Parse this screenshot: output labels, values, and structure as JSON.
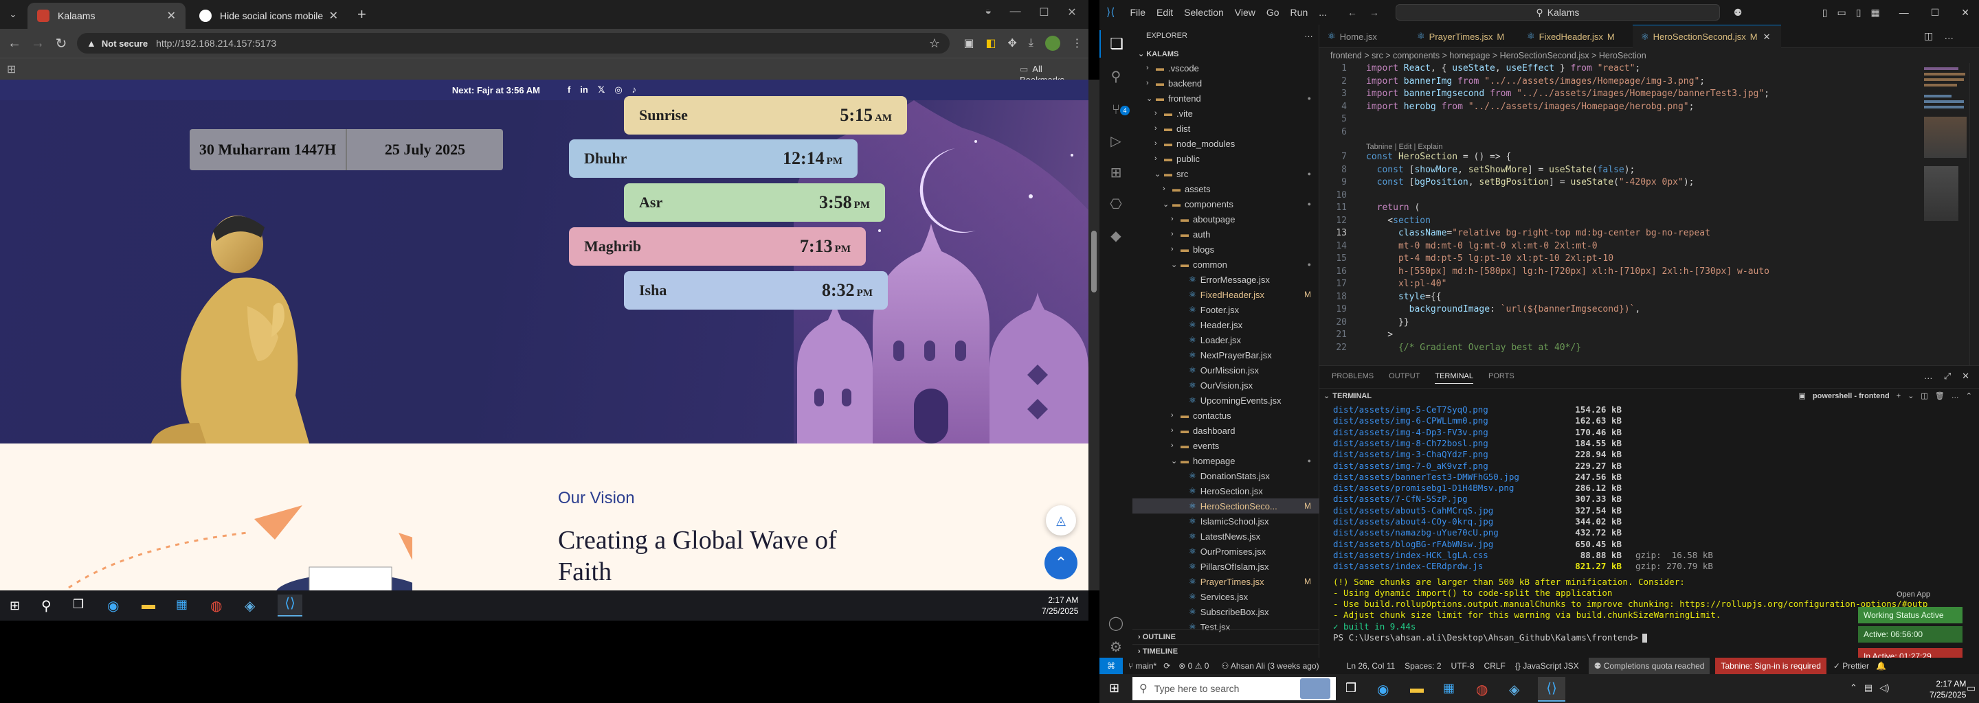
{
  "chrome": {
    "tabs": [
      {
        "label": "Kalaams",
        "active": true
      },
      {
        "label": "Hide social icons mobile",
        "active": false
      }
    ],
    "new_tab": "+",
    "security": "Not secure",
    "url": "http://192.168.214.157:5173",
    "all_bookmarks": "All Bookmarks"
  },
  "site": {
    "topbar": {
      "text": "Next: Fajr at 3:56 AM"
    },
    "dates": {
      "hijri": "30 Muharram 1447H",
      "gregorian": "25 July 2025"
    },
    "prayers": [
      {
        "name": "Sunrise",
        "time": "5:15",
        "ampm": "AM",
        "color": "#e9d7a6"
      },
      {
        "name": "Dhuhr",
        "time": "12:14",
        "ampm": "PM",
        "color": "#a9c7e2"
      },
      {
        "name": "Asr",
        "time": "3:58",
        "ampm": "PM",
        "color": "#b9dcb2"
      },
      {
        "name": "Maghrib",
        "time": "7:13",
        "ampm": "PM",
        "color": "#e3a8b9"
      },
      {
        "name": "Isha",
        "time": "8:32",
        "ampm": "PM",
        "color": "#b3c8e8"
      }
    ],
    "vision": {
      "eyebrow": "Our Vision",
      "title_line1": "Creating a Global Wave of",
      "title_line2": "Faith"
    }
  },
  "taskbar_left": {
    "time": "2:17 AM",
    "date": "7/25/2025"
  },
  "vscode": {
    "menu": [
      "File",
      "Edit",
      "Selection",
      "View",
      "Go",
      "Run",
      "..."
    ],
    "search": "Kalams",
    "editor_tabs": [
      {
        "label": "Home.jsx",
        "mod": ""
      },
      {
        "label": "PrayerTimes.jsx",
        "mod": "M"
      },
      {
        "label": "FixedHeader.jsx",
        "mod": "M"
      },
      {
        "label": "HeroSectionSecond.jsx",
        "mod": "M"
      }
    ],
    "breadcrumb": "frontend > src > components > homepage > HeroSectionSecond.jsx > HeroSection",
    "explorer_title": "EXPLORER",
    "root": "KALAMS",
    "tree": [
      {
        "label": ".vscode",
        "depth": 1,
        "type": "folder-closed",
        "mod": ""
      },
      {
        "label": "backend",
        "depth": 1,
        "type": "folder-closed",
        "mod": ""
      },
      {
        "label": "frontend",
        "depth": 1,
        "type": "folder-open",
        "mod": "dot"
      },
      {
        "label": ".vite",
        "depth": 2,
        "type": "folder-closed",
        "mod": ""
      },
      {
        "label": "dist",
        "depth": 2,
        "type": "folder-closed",
        "mod": ""
      },
      {
        "label": "node_modules",
        "depth": 2,
        "type": "folder-closed",
        "mod": ""
      },
      {
        "label": "public",
        "depth": 2,
        "type": "folder-closed",
        "mod": ""
      },
      {
        "label": "src",
        "depth": 2,
        "type": "folder-open",
        "mod": "dot"
      },
      {
        "label": "assets",
        "depth": 3,
        "type": "folder-closed",
        "mod": ""
      },
      {
        "label": "components",
        "depth": 3,
        "type": "folder-open",
        "mod": "dot"
      },
      {
        "label": "aboutpage",
        "depth": 4,
        "type": "folder-closed",
        "mod": ""
      },
      {
        "label": "auth",
        "depth": 4,
        "type": "folder-closed",
        "mod": ""
      },
      {
        "label": "blogs",
        "depth": 4,
        "type": "folder-closed",
        "mod": ""
      },
      {
        "label": "common",
        "depth": 4,
        "type": "folder-open",
        "mod": "dot"
      },
      {
        "label": "ErrorMessage.jsx",
        "depth": 5,
        "type": "file",
        "mod": ""
      },
      {
        "label": "FixedHeader.jsx",
        "depth": 5,
        "type": "file",
        "mod": "M"
      },
      {
        "label": "Footer.jsx",
        "depth": 5,
        "type": "file",
        "mod": ""
      },
      {
        "label": "Header.jsx",
        "depth": 5,
        "type": "file",
        "mod": ""
      },
      {
        "label": "Loader.jsx",
        "depth": 5,
        "type": "file",
        "mod": ""
      },
      {
        "label": "NextPrayerBar.jsx",
        "depth": 5,
        "type": "file",
        "mod": ""
      },
      {
        "label": "OurMission.jsx",
        "depth": 5,
        "type": "file",
        "mod": ""
      },
      {
        "label": "OurVision.jsx",
        "depth": 5,
        "type": "file",
        "mod": ""
      },
      {
        "label": "UpcomingEvents.jsx",
        "depth": 5,
        "type": "file",
        "mod": ""
      },
      {
        "label": "contactus",
        "depth": 4,
        "type": "folder-closed",
        "mod": ""
      },
      {
        "label": "dashboard",
        "depth": 4,
        "type": "folder-closed",
        "mod": ""
      },
      {
        "label": "events",
        "depth": 4,
        "type": "folder-closed",
        "mod": ""
      },
      {
        "label": "homepage",
        "depth": 4,
        "type": "folder-open",
        "mod": "dot"
      },
      {
        "label": "DonationStats.jsx",
        "depth": 5,
        "type": "file",
        "mod": ""
      },
      {
        "label": "HeroSection.jsx",
        "depth": 5,
        "type": "file",
        "mod": ""
      },
      {
        "label": "HeroSectionSeco...",
        "depth": 5,
        "type": "file",
        "mod": "M",
        "selected": true
      },
      {
        "label": "IslamicSchool.jsx",
        "depth": 5,
        "type": "file",
        "mod": ""
      },
      {
        "label": "LatestNews.jsx",
        "depth": 5,
        "type": "file",
        "mod": ""
      },
      {
        "label": "OurPromises.jsx",
        "depth": 5,
        "type": "file",
        "mod": ""
      },
      {
        "label": "PillarsOfIslam.jsx",
        "depth": 5,
        "type": "file",
        "mod": ""
      },
      {
        "label": "PrayerTimes.jsx",
        "depth": 5,
        "type": "file",
        "mod": "M"
      },
      {
        "label": "Services.jsx",
        "depth": 5,
        "type": "file",
        "mod": ""
      },
      {
        "label": "SubscribeBox.jsx",
        "depth": 5,
        "type": "file",
        "mod": ""
      },
      {
        "label": "Test.jsx",
        "depth": 5,
        "type": "file",
        "mod": ""
      }
    ],
    "outline": "OUTLINE",
    "timeline": "TIMELINE",
    "tabnine": "Tabnine | Edit | Explain",
    "code": [
      {
        "n": "1",
        "segs": [
          [
            "kw",
            "import "
          ],
          [
            "var",
            "React"
          ],
          [
            "pl",
            ", { "
          ],
          [
            "var",
            "useState"
          ],
          [
            "pl",
            ", "
          ],
          [
            "var",
            "useEffect"
          ],
          [
            "pl",
            " } "
          ],
          [
            "kw",
            "from "
          ],
          [
            "str",
            "\"react\""
          ],
          [
            "pl",
            ";"
          ]
        ]
      },
      {
        "n": "2",
        "segs": [
          [
            "kw",
            "import "
          ],
          [
            "var",
            "bannerImg "
          ],
          [
            "kw",
            "from "
          ],
          [
            "str",
            "\"../../assets/images/Homepage/img-3.png\""
          ],
          [
            "pl",
            ";"
          ]
        ]
      },
      {
        "n": "3",
        "segs": [
          [
            "kw",
            "import "
          ],
          [
            "var",
            "bannerImgsecond "
          ],
          [
            "kw",
            "from "
          ],
          [
            "str",
            "\"../../assets/images/Homepage/bannerTest3.jpg\""
          ],
          [
            "pl",
            ";"
          ]
        ]
      },
      {
        "n": "4",
        "segs": [
          [
            "kw",
            "import "
          ],
          [
            "var",
            "herobg "
          ],
          [
            "kw",
            "from "
          ],
          [
            "str",
            "\"../../assets/images/Homepage/herobg.png\""
          ],
          [
            "pl",
            ";"
          ]
        ]
      },
      {
        "n": "5",
        "segs": []
      },
      {
        "n": "6",
        "segs": []
      },
      {
        "n": "7",
        "segs": [
          [
            "kw2",
            "const "
          ],
          [
            "fn",
            "HeroSection "
          ],
          [
            "pl",
            "= () => {"
          ]
        ]
      },
      {
        "n": "8",
        "segs": [
          [
            "pl",
            "  "
          ],
          [
            "kw2",
            "const "
          ],
          [
            "pl",
            "["
          ],
          [
            "var",
            "showMore"
          ],
          [
            "pl",
            ", "
          ],
          [
            "fn",
            "setShowMore"
          ],
          [
            "pl",
            "] = "
          ],
          [
            "fn",
            "useState"
          ],
          [
            "pl",
            "("
          ],
          [
            "kw2",
            "false"
          ],
          [
            "pl",
            ");"
          ]
        ]
      },
      {
        "n": "9",
        "segs": [
          [
            "pl",
            "  "
          ],
          [
            "kw2",
            "const "
          ],
          [
            "pl",
            "["
          ],
          [
            "var",
            "bgPosition"
          ],
          [
            "pl",
            ", "
          ],
          [
            "fn",
            "setBgPosition"
          ],
          [
            "pl",
            "] = "
          ],
          [
            "fn",
            "useState"
          ],
          [
            "pl",
            "("
          ],
          [
            "str",
            "\"-420px 0px\""
          ],
          [
            "pl",
            ");"
          ]
        ]
      },
      {
        "n": "10",
        "segs": []
      },
      {
        "n": "11",
        "segs": [
          [
            "pl",
            "  "
          ],
          [
            "kw",
            "return "
          ],
          [
            "pl",
            "("
          ]
        ]
      },
      {
        "n": "12",
        "segs": [
          [
            "pl",
            "    <"
          ],
          [
            "tag",
            "section"
          ]
        ]
      },
      {
        "n": "13",
        "segs": [
          [
            "pl",
            "      "
          ],
          [
            "attr",
            "className"
          ],
          [
            "pl",
            "="
          ],
          [
            "str",
            "\"relative bg-right-top md:bg-center bg-no-repeat"
          ]
        ]
      },
      {
        "n": "14",
        "segs": [
          [
            "str",
            "      mt-0 md:mt-0 lg:mt-0 xl:mt-0 2xl:mt-0"
          ]
        ]
      },
      {
        "n": "15",
        "segs": [
          [
            "str",
            "      pt-4 md:pt-5 lg:pt-10 xl:pt-10 2xl:pt-10"
          ]
        ]
      },
      {
        "n": "16",
        "segs": [
          [
            "str",
            "      h-[550px] md:h-[580px] lg:h-[720px] xl:h-[710px] 2xl:h-[730px] w-auto"
          ]
        ]
      },
      {
        "n": "17",
        "segs": [
          [
            "str",
            "      xl:pl-40\""
          ]
        ]
      },
      {
        "n": "18",
        "segs": [
          [
            "pl",
            "      "
          ],
          [
            "attr",
            "style"
          ],
          [
            "pl",
            "={{"
          ]
        ]
      },
      {
        "n": "19",
        "segs": [
          [
            "pl",
            "        "
          ],
          [
            "var",
            "backgroundImage"
          ],
          [
            "pl",
            ": "
          ],
          [
            "str",
            "`url(${bannerImgsecond})`"
          ],
          [
            "pl",
            ","
          ]
        ]
      },
      {
        "n": "20",
        "segs": [
          [
            "pl",
            "      }}"
          ]
        ]
      },
      {
        "n": "21",
        "segs": [
          [
            "pl",
            "    >"
          ]
        ]
      },
      {
        "n": "22",
        "segs": [
          [
            "pl",
            "      "
          ],
          [
            "cm",
            "{/* Gradient Overlay best at 40*/}"
          ]
        ]
      }
    ],
    "panel_tabs": [
      "PROBLEMS",
      "OUTPUT",
      "TERMINAL",
      "PORTS"
    ],
    "terminal_title": "TERMINAL",
    "terminal_shell": "powershell - frontend",
    "terminal_files": [
      {
        "path": "dist/assets/img-5-CeT7SyqQ.png",
        "size": "154.26 kB",
        "gzip": ""
      },
      {
        "path": "dist/assets/img-6-CPWLLmm0.png",
        "size": "162.63 kB",
        "gzip": ""
      },
      {
        "path": "dist/assets/img-4-Dp3-FV3v.png",
        "size": "170.46 kB",
        "gzip": ""
      },
      {
        "path": "dist/assets/img-8-Ch72bosl.png",
        "size": "184.55 kB",
        "gzip": ""
      },
      {
        "path": "dist/assets/img-3-ChaQYdzF.png",
        "size": "228.94 kB",
        "gzip": ""
      },
      {
        "path": "dist/assets/img-7-0_aK9vzf.png",
        "size": "229.27 kB",
        "gzip": ""
      },
      {
        "path": "dist/assets/bannerTest3-DMWFhG50.jpg",
        "size": "247.56 kB",
        "gzip": ""
      },
      {
        "path": "dist/assets/promisebg1-D1H4BMsv.png",
        "size": "286.12 kB",
        "gzip": ""
      },
      {
        "path": "dist/assets/7-CfN-5SzP.jpg",
        "size": "307.33 kB",
        "gzip": ""
      },
      {
        "path": "dist/assets/about5-CahMCrqS.jpg",
        "size": "327.54 kB",
        "gzip": ""
      },
      {
        "path": "dist/assets/about4-COy-0krq.jpg",
        "size": "344.02 kB",
        "gzip": ""
      },
      {
        "path": "dist/assets/namazbg-uYue70cU.png",
        "size": "432.72 kB",
        "gzip": ""
      },
      {
        "path": "dist/assets/blogBG-rFAbWNsw.jpg",
        "size": "650.45 kB",
        "gzip": ""
      },
      {
        "path": "dist/assets/index-HCK_lgLA.css",
        "size": "88.88 kB",
        "gzip": "gzip:  16.58 kB"
      },
      {
        "path": "dist/assets/index-CERdprdw.js",
        "size": "821.27 kB",
        "gzip": "gzip: 270.79 kB"
      }
    ],
    "terminal_warn": [
      "(!) Some chunks are larger than 500 kB after minification. Consider:",
      "- Using dynamic import() to code-split the application",
      "- Use build.rollupOptions.output.manualChunks to improve chunking: https://rollupjs.org/configuration-options/#outp",
      "- Adjust chunk size limit for this warning via build.chunkSizeWarningLimit."
    ],
    "terminal_built": "✓ built in 9.44s",
    "terminal_prompt": "PS C:\\Users\\ahsan.ali\\Desktop\\Ahsan_Github\\Kalams\\frontend>",
    "open_app": "Open App",
    "working_status": "Working Status Active",
    "active_time": "Active: 06:56:00",
    "inactive_time": "In Active: 01:27:29",
    "status": {
      "branch": "main*",
      "errors": "⊗ 0 ⚠ 0",
      "blame": "Ahsan Ali (3 weeks ago)",
      "position": "Ln 26, Col 11",
      "spaces": "Spaces: 2",
      "encoding": "UTF-8",
      "eol": "CRLF",
      "lang": "{} JavaScript JSX",
      "quota": "Completions quota reached",
      "tabnine": "Tabnine: Sign-in is required",
      "prettier": "✓ Prettier"
    }
  },
  "taskbar_right": {
    "search": "Type here to search",
    "time": "2:17 AM",
    "date": "7/25/2025"
  }
}
